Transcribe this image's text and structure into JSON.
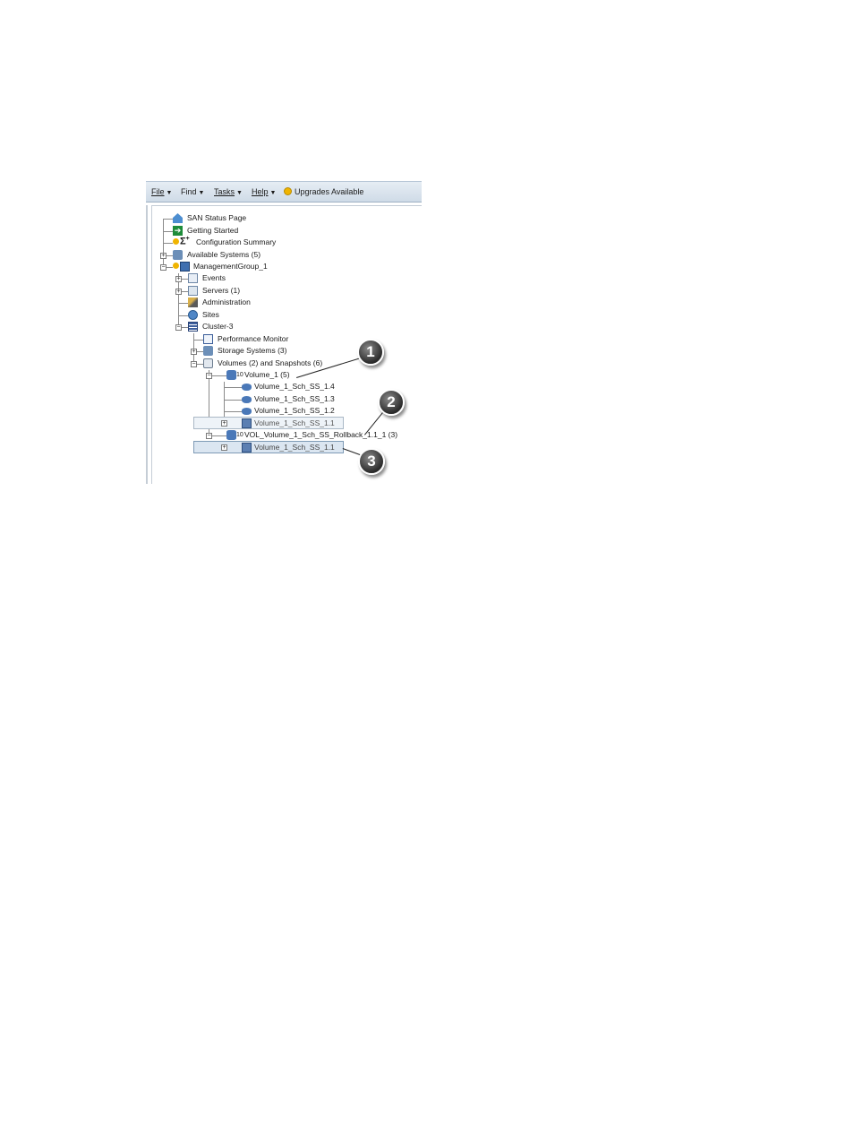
{
  "menu": {
    "file": "File",
    "find": "Find",
    "tasks": "Tasks",
    "help": "Help",
    "upgrades": "Upgrades Available"
  },
  "tree": {
    "san_status": "SAN Status Page",
    "getting_started": "Getting Started",
    "config_summary": "Configuration Summary",
    "available_systems": "Available Systems (5)",
    "management_group": "ManagementGroup_1",
    "events": "Events",
    "servers": "Servers (1)",
    "administration": "Administration",
    "sites": "Sites",
    "cluster": "Cluster-3",
    "performance_monitor": "Performance Monitor",
    "storage_systems": "Storage Systems (3)",
    "volumes_snapshots": "Volumes (2) and Snapshots (6)",
    "volume_1": "Volume_1 (5)",
    "ss_1_4": "Volume_1_Sch_SS_1.4",
    "ss_1_3": "Volume_1_Sch_SS_1.3",
    "ss_1_2": "Volume_1_Sch_SS_1.2",
    "ss_1_1a": "Volume_1_Sch_SS_1.1",
    "rollback": "VOL_Volume_1_Sch_SS_Rollback_1.1_1 (3)",
    "ss_1_1b": "Volume_1_Sch_SS_1.1"
  },
  "callouts": [
    "1",
    "2",
    "3"
  ],
  "colors": {
    "menubar": "#d6e1ec",
    "selection": "#dbe6f1",
    "callout": "#3a3a3a"
  }
}
